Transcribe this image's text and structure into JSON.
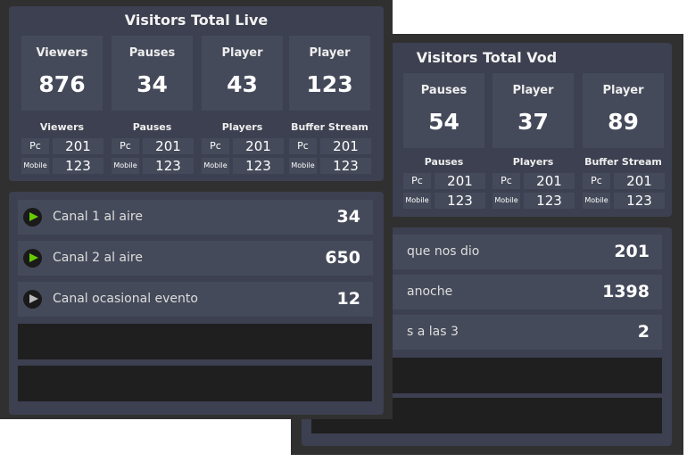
{
  "live": {
    "title": "Visitors Total Live",
    "tiles": [
      {
        "label": "Viewers",
        "value": "876"
      },
      {
        "label": "Pauses",
        "value": "34"
      },
      {
        "label": "Player",
        "value": "43"
      },
      {
        "label": "Player",
        "value": "123"
      }
    ],
    "breakdown": [
      {
        "label": "Viewers",
        "pc": "201",
        "mobile": "123"
      },
      {
        "label": "Pauses",
        "pc": "201",
        "mobile": "123"
      },
      {
        "label": "Players",
        "pc": "201",
        "mobile": "123"
      },
      {
        "label": "Buffer Stream",
        "pc": "201",
        "mobile": "123"
      }
    ],
    "pc_label": "Pc",
    "mobile_label": "Mobile",
    "channels": [
      {
        "name": "Canal 1 al aire",
        "value": "34",
        "icon": "play-icon",
        "color": "#66cc00"
      },
      {
        "name": "Canal 2 al aire",
        "value": "650",
        "icon": "play-icon",
        "color": "#66cc00"
      },
      {
        "name": "Canal ocasional evento",
        "value": "12",
        "icon": "play-icon",
        "color": "#bbbbbb"
      }
    ]
  },
  "vod": {
    "title": "Visitors Total Vod",
    "tiles": [
      {
        "label": "Pauses",
        "value": "54"
      },
      {
        "label": "Player",
        "value": "37"
      },
      {
        "label": "Player",
        "value": "89"
      }
    ],
    "breakdown": [
      {
        "label": "Pauses",
        "pc": "201",
        "mobile": "123"
      },
      {
        "label": "Players",
        "pc": "201",
        "mobile": "123"
      },
      {
        "label": "Buffer Stream",
        "pc": "201",
        "mobile": "123"
      }
    ],
    "pc_label": "Pc",
    "mobile_label": "Mobile",
    "items": [
      {
        "name": "que nos dio",
        "value": "201"
      },
      {
        "name": "anoche",
        "value": "1398"
      },
      {
        "name": "s a las 3",
        "value": "2"
      }
    ]
  }
}
